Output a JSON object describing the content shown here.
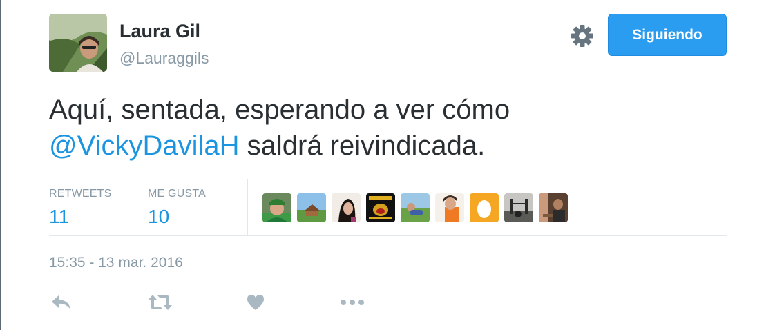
{
  "user": {
    "name": "Laura Gil",
    "handle": "@Lauraggils"
  },
  "header": {
    "follow_label": "Siguiendo",
    "settings_icon": "gear-icon"
  },
  "tweet": {
    "text_before": "Aquí, sentada, esperando a ver cómo",
    "mention": "@VickyDavilaH",
    "text_after": " saldrá reivindicada."
  },
  "stats": {
    "retweets_label": "RETWEETS",
    "retweets_count": "11",
    "likes_label": "ME GUSTA",
    "likes_count": "10"
  },
  "likers": [
    "liker-1",
    "liker-2",
    "liker-3",
    "liker-4",
    "liker-5",
    "liker-6",
    "liker-7",
    "liker-8",
    "liker-9"
  ],
  "timestamp": "15:35 - 13 mar. 2016",
  "actions": [
    "reply-icon",
    "retweet-icon",
    "like-icon",
    "more-icon"
  ],
  "colors": {
    "accent": "#1b95e0",
    "button": "#2b9df0",
    "muted": "#8899a6",
    "text": "#292f33"
  }
}
